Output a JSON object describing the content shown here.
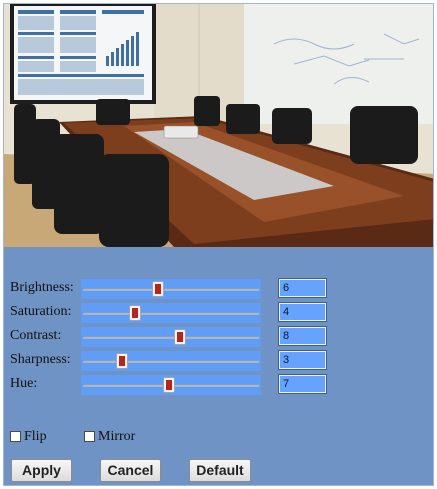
{
  "preview": {
    "icon": "conference-room-preview-image"
  },
  "adjustments": [
    {
      "key": "brightness",
      "label": "Brightness:",
      "value": "6",
      "level": 0.43
    },
    {
      "key": "saturation",
      "label": "Saturation:",
      "value": "4",
      "level": 0.29
    },
    {
      "key": "contrast",
      "label": "Contrast:",
      "value": "8",
      "level": 0.57
    },
    {
      "key": "sharpness",
      "label": "Sharpness:",
      "value": "3",
      "level": 0.21
    },
    {
      "key": "hue",
      "label": "Hue:",
      "value": "7",
      "level": 0.5
    }
  ],
  "options": {
    "flip_label": "Flip",
    "mirror_label": "Mirror",
    "flip_checked": false,
    "mirror_checked": false
  },
  "buttons": {
    "apply_label": "Apply",
    "cancel_label": "Cancel",
    "default_label": "Default"
  },
  "colors": {
    "panel": "#6f93c4",
    "slider_bg": "#5f9df6",
    "thumb": "#b8231a",
    "value_box": "#66a3ff"
  }
}
